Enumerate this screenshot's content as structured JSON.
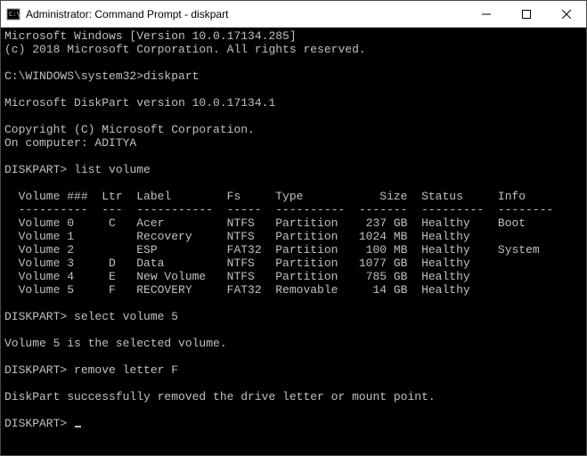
{
  "window": {
    "title": "Administrator: Command Prompt - diskpart"
  },
  "console": {
    "header1": "Microsoft Windows [Version 10.0.17134.285]",
    "header2": "(c) 2018 Microsoft Corporation. All rights reserved.",
    "prompt1_path": "C:\\WINDOWS\\system32>",
    "prompt1_cmd": "diskpart",
    "dp_version": "Microsoft DiskPart version 10.0.17134.1",
    "dp_copyright": "Copyright (C) Microsoft Corporation.",
    "dp_computer": "On computer: ADITYA",
    "dp_prompt": "DISKPART>",
    "cmd_list": "list volume",
    "cmd_select": "select volume 5",
    "cmd_remove": "remove letter F",
    "msg_selected": "Volume 5 is the selected volume.",
    "msg_removed": "DiskPart successfully removed the drive letter or mount point.",
    "table": {
      "hdr_vol": "Volume ###",
      "hdr_ltr": "Ltr",
      "hdr_label": "Label",
      "hdr_fs": "Fs",
      "hdr_type": "Type",
      "hdr_size": "Size",
      "hdr_status": "Status",
      "hdr_info": "Info",
      "rows": [
        {
          "vol": "Volume 0",
          "ltr": "C",
          "label": "Acer",
          "fs": "NTFS",
          "type": "Partition",
          "size": "237 GB",
          "status": "Healthy",
          "info": "Boot"
        },
        {
          "vol": "Volume 1",
          "ltr": "",
          "label": "Recovery",
          "fs": "NTFS",
          "type": "Partition",
          "size": "1024 MB",
          "status": "Healthy",
          "info": ""
        },
        {
          "vol": "Volume 2",
          "ltr": "",
          "label": "ESP",
          "fs": "FAT32",
          "type": "Partition",
          "size": "100 MB",
          "status": "Healthy",
          "info": "System"
        },
        {
          "vol": "Volume 3",
          "ltr": "D",
          "label": "Data",
          "fs": "NTFS",
          "type": "Partition",
          "size": "1077 GB",
          "status": "Healthy",
          "info": ""
        },
        {
          "vol": "Volume 4",
          "ltr": "E",
          "label": "New Volume",
          "fs": "NTFS",
          "type": "Partition",
          "size": "785 GB",
          "status": "Healthy",
          "info": ""
        },
        {
          "vol": "Volume 5",
          "ltr": "F",
          "label": "RECOVERY",
          "fs": "FAT32",
          "type": "Removable",
          "size": "14 GB",
          "status": "Healthy",
          "info": ""
        }
      ]
    }
  }
}
